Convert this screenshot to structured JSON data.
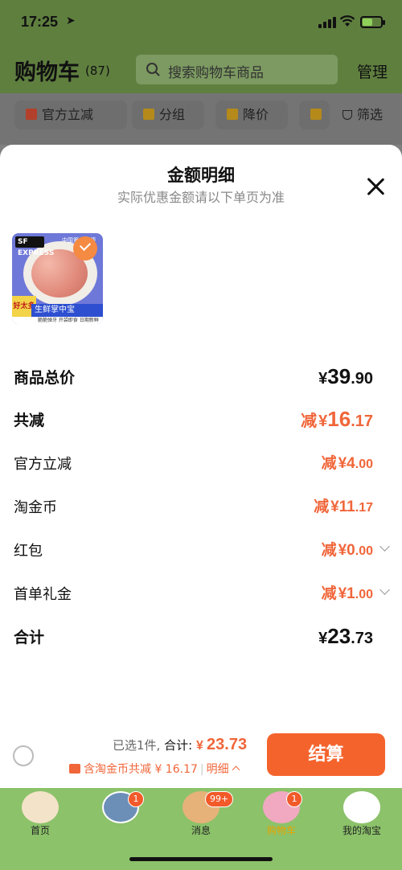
{
  "status_bar": {
    "time": "17:25"
  },
  "header": {
    "title": "购物车",
    "count": "(87)",
    "search_placeholder": "搜索购物车商品",
    "manage_label": "管理"
  },
  "filters": [
    {
      "label": "官方立减"
    },
    {
      "label": "分组"
    },
    {
      "label": "降价"
    },
    {
      "label": "筛选"
    }
  ],
  "sheet": {
    "title": "金额明细",
    "subtitle": "实际优惠金额请以下单页为准",
    "product_image": {
      "sf_label": "SF EXPRESS",
      "top_tag": "中国第一方便",
      "band_text": "生鲜掌中宝",
      "left_badge": "好太多",
      "footer_text": "脆脆弹牙 开袋即食 日期新鲜"
    },
    "rows": [
      {
        "label": "商品总价",
        "prefix": "",
        "currency": "¥",
        "integer": "39",
        "decimal": ".90"
      },
      {
        "label": "共减",
        "prefix": "减",
        "currency": "¥",
        "integer": "16",
        "decimal": ".17"
      },
      {
        "label": "官方立减",
        "prefix": "减",
        "currency": "¥",
        "integer": "4",
        "decimal": ".00"
      },
      {
        "label": "淘金币",
        "prefix": "减",
        "currency": "¥",
        "integer": "11",
        "decimal": ".17"
      },
      {
        "label": "红包",
        "prefix": "减",
        "currency": "¥",
        "integer": "0",
        "decimal": ".00"
      },
      {
        "label": "首单礼金",
        "prefix": "减",
        "currency": "¥",
        "integer": "1",
        "decimal": ".00"
      },
      {
        "label": "合计",
        "prefix": "",
        "currency": "¥",
        "integer": "23",
        "decimal": ".73"
      }
    ]
  },
  "footer": {
    "selected_text": "已选1件,",
    "total_label": "合计:",
    "total_currency": "¥",
    "total_value": "23.73",
    "coin_text": "含淘金币共减 ¥ 16.17",
    "detail_label": "明细",
    "checkout_label": "结算"
  },
  "tabbar": [
    {
      "label": "首页",
      "badge": ""
    },
    {
      "label": "",
      "badge": "1"
    },
    {
      "label": "消息",
      "badge": "99+"
    },
    {
      "label": "购物车",
      "badge": "1"
    },
    {
      "label": "我的淘宝",
      "badge": ""
    }
  ],
  "colors": {
    "accent": "#f0663a",
    "checkout_button": "#f5632d",
    "tabbar_bg": "#8cc26a"
  }
}
